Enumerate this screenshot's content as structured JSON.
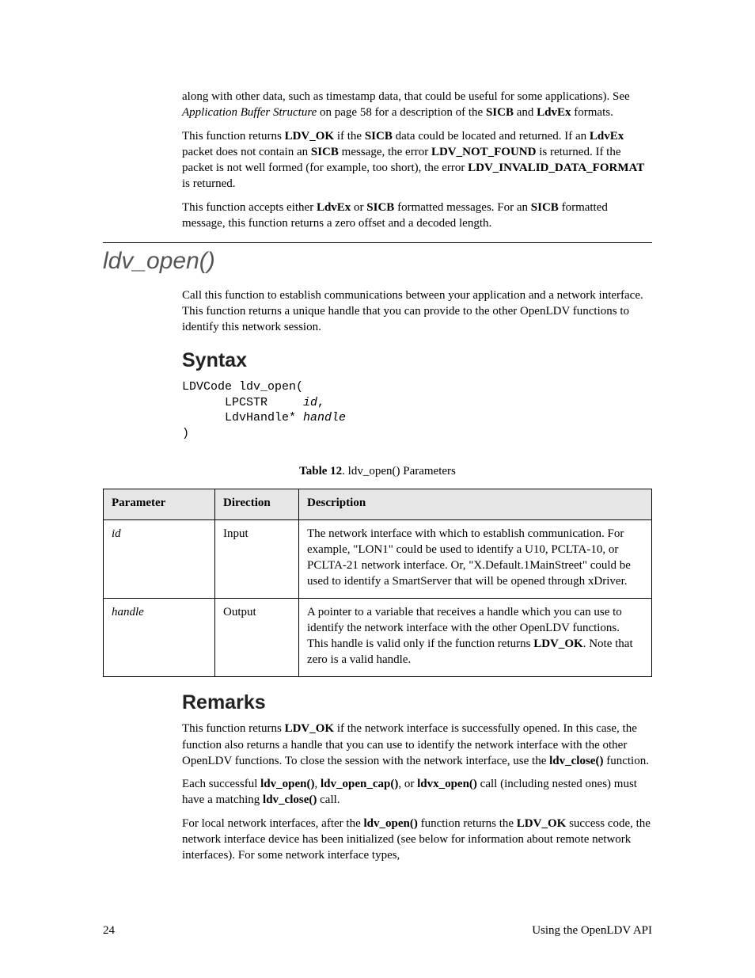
{
  "intro": {
    "p1_a": "along with other data, such as timestamp data, that could be useful for some applications).  See ",
    "p1_em": "Application Buffer Structure",
    "p1_b": " on page 58 for a description of the ",
    "p1_bold1": "SICB",
    "p1_c": " and ",
    "p1_bold2": "LdvEx",
    "p1_d": " formats.",
    "p2_a": "This function returns ",
    "p2_b1": "LDV_OK",
    "p2_b": " if the ",
    "p2_b2": "SICB",
    "p2_c": " data could be located and returned.  If an ",
    "p2_b3": "LdvEx",
    "p2_d": " packet does not contain an ",
    "p2_b4": "SICB",
    "p2_e": " message, the error ",
    "p2_b5": "LDV_NOT_FOUND",
    "p2_f": " is returned.  If the packet is not well formed (for example, too short), the error ",
    "p2_b6": "LDV_INVALID_DATA_FORMAT",
    "p2_g": " is returned.",
    "p3_a": "This function accepts either ",
    "p3_b1": "LdvEx",
    "p3_b": " or ",
    "p3_b2": "SICB",
    "p3_c": " formatted messages.  For an ",
    "p3_b3": "SICB",
    "p3_d": " formatted message, this function returns a zero offset and a decoded length."
  },
  "section": {
    "title": "ldv_open()",
    "desc": "Call this function to establish communications between your application and a network interface.  This function returns a unique handle that you can provide to the other OpenLDV functions to identify this network session."
  },
  "syntax": {
    "heading": "Syntax",
    "l1": "LDVCode ldv_open(",
    "l2a": "      LPCSTR     ",
    "l2b": "id",
    "l2c": ",",
    "l3a": "      LdvHandle* ",
    "l3b": "handle",
    "l4": ")"
  },
  "table": {
    "caption_b": "Table 12",
    "caption_rest": ". ldv_open() Parameters",
    "h1": "Parameter",
    "h2": "Direction",
    "h3": "Description",
    "rows": [
      {
        "param": "id",
        "dir": "Input",
        "desc": "The network interface with which to establish communication.  For example, \"LON1\" could be used to identify a U10, PCLTA-10, or PCLTA-21 network interface.  Or, \"X.Default.1MainStreet\" could be used to identify a SmartServer that will be opened through xDriver."
      },
      {
        "param": "handle",
        "dir": "Output",
        "desc_a": "A pointer to a variable that receives a handle which you can use to identify the network interface with the other OpenLDV functions.  This handle is valid only if the function returns ",
        "desc_b": "LDV_OK",
        "desc_c": ".  Note that zero is a valid handle."
      }
    ]
  },
  "remarks": {
    "heading": "Remarks",
    "p1_a": "This function returns ",
    "p1_b1": "LDV_OK",
    "p1_b": " if the network interface is successfully opened.  In this case, the function also returns a handle that you can use to identify the network interface with the other OpenLDV functions.  To close the session with the network interface, use the ",
    "p1_b2": "ldv_close()",
    "p1_c": " function.",
    "p2_a": "Each successful ",
    "p2_b1": "ldv_open()",
    "p2_b": ", ",
    "p2_b2": "ldv_open_cap()",
    "p2_c": ", or ",
    "p2_b3": "ldvx_open()",
    "p2_d": " call (including nested ones) must have a matching ",
    "p2_b4": "ldv_close()",
    "p2_e": " call.",
    "p3_a": "For local network interfaces, after the ",
    "p3_b1": "ldv_open()",
    "p3_b": " function returns the ",
    "p3_b2": "LDV_OK",
    "p3_c": " success code, the network interface device has been initialized (see below for information about remote network interfaces).  For some network interface types,"
  },
  "footer": {
    "page_num": "24",
    "book": "Using the OpenLDV API"
  }
}
